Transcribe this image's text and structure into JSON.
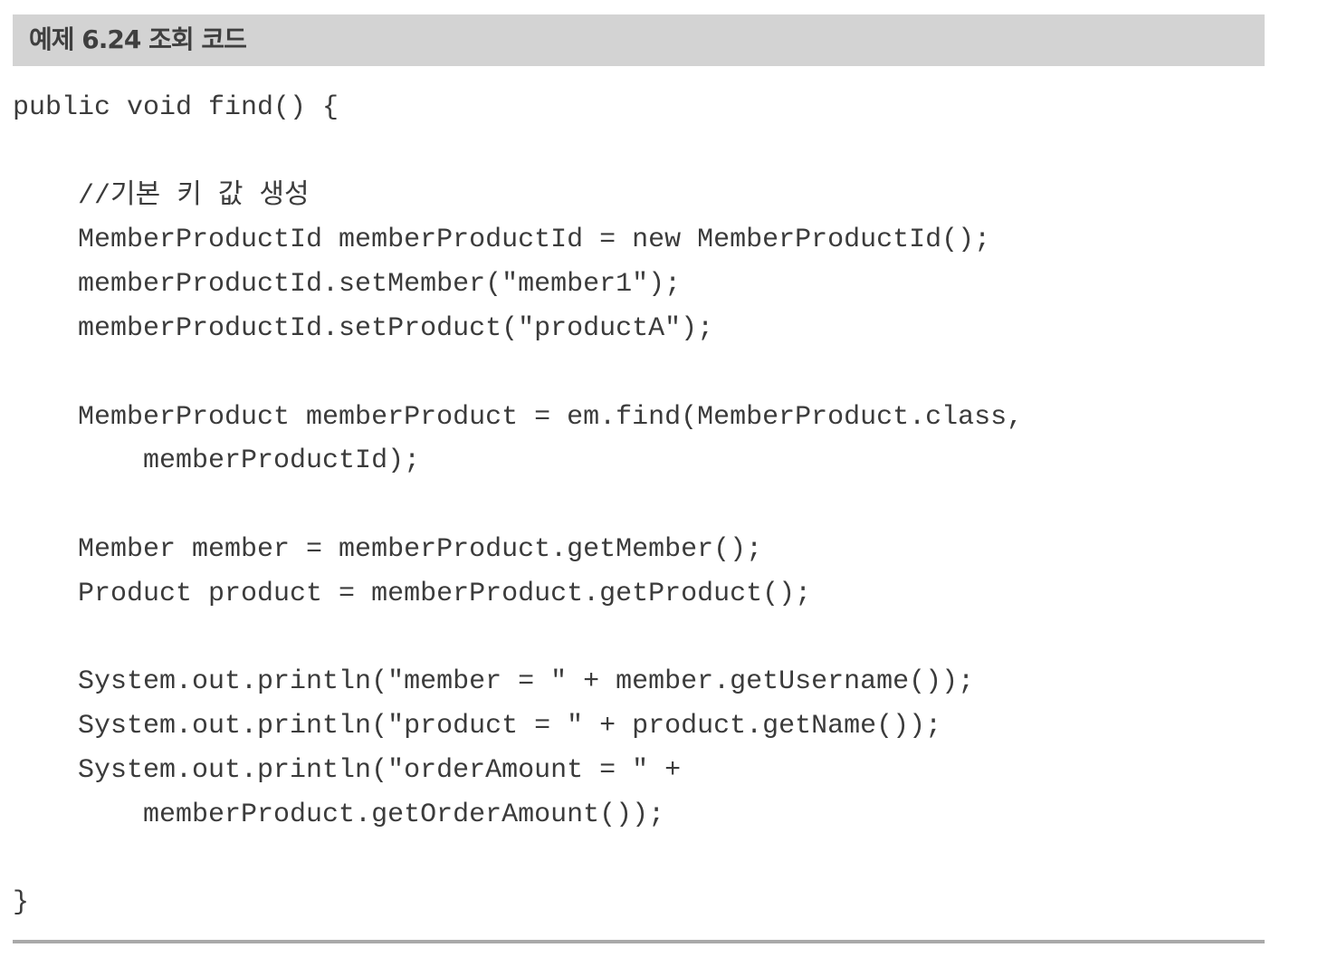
{
  "caption": {
    "label": "예제 6.24  조회 코드"
  },
  "code": {
    "lines": [
      "public void find() {",
      "",
      "    //기본 키 값 생성",
      "    MemberProductId memberProductId = new MemberProductId();",
      "    memberProductId.setMember(\"member1\");",
      "    memberProductId.setProduct(\"productA\");",
      "",
      "    MemberProduct memberProduct = em.find(MemberProduct.class,",
      "        memberProductId);",
      "",
      "    Member member = memberProduct.getMember();",
      "    Product product = memberProduct.getProduct();",
      "",
      "    System.out.println(\"member = \" + member.getUsername());",
      "    System.out.println(\"product = \" + product.getName());",
      "    System.out.println(\"orderAmount = \" +",
      "        memberProduct.getOrderAmount());",
      "",
      "}"
    ]
  }
}
